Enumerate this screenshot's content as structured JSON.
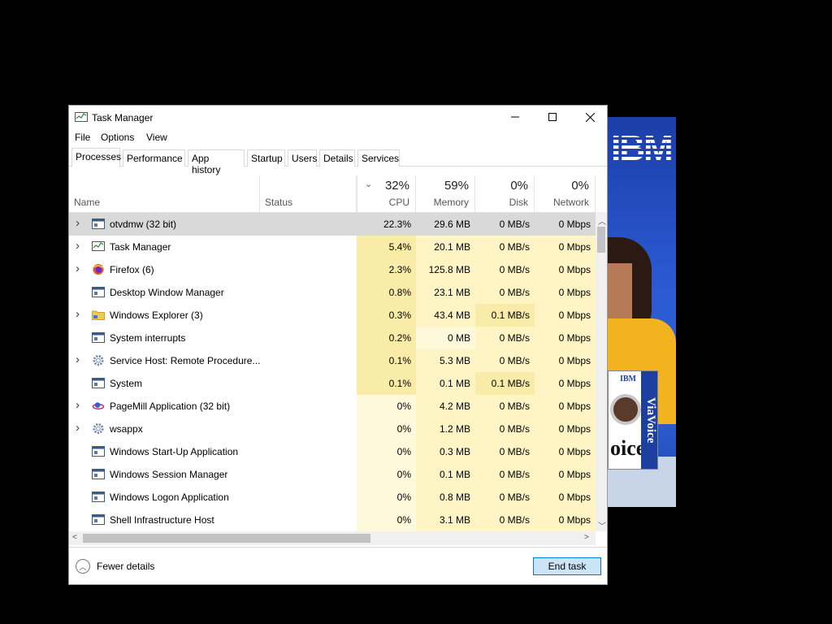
{
  "window": {
    "title": "Task Manager",
    "controls": {
      "minimize": "—",
      "maximize": "☐",
      "close": "✕"
    }
  },
  "menu": [
    "File",
    "Options",
    "View"
  ],
  "tabs": [
    "Processes",
    "Performance",
    "App history",
    "Startup",
    "Users",
    "Details",
    "Services"
  ],
  "active_tab": "Processes",
  "columns": {
    "name": "Name",
    "status": "Status",
    "cpu": {
      "pct": "32%",
      "label": "CPU"
    },
    "memory": {
      "pct": "59%",
      "label": "Memory"
    },
    "disk": {
      "pct": "0%",
      "label": "Disk"
    },
    "network": {
      "pct": "0%",
      "label": "Network"
    }
  },
  "rows": [
    {
      "name": "otvdmw (32 bit)",
      "expand": true,
      "icon": "app-window-icon",
      "cpu": "22.3%",
      "mem": "29.6 MB",
      "disk": "0 MB/s",
      "net": "0 Mbps",
      "selected": true
    },
    {
      "name": "Task Manager",
      "expand": true,
      "icon": "task-manager-icon",
      "cpu": "5.4%",
      "mem": "20.1 MB",
      "disk": "0 MB/s",
      "net": "0 Mbps"
    },
    {
      "name": "Firefox (6)",
      "expand": true,
      "icon": "firefox-icon",
      "cpu": "2.3%",
      "mem": "125.8 MB",
      "disk": "0 MB/s",
      "net": "0 Mbps"
    },
    {
      "name": "Desktop Window Manager",
      "expand": false,
      "icon": "app-window-icon",
      "cpu": "0.8%",
      "mem": "23.1 MB",
      "disk": "0 MB/s",
      "net": "0 Mbps"
    },
    {
      "name": "Windows Explorer (3)",
      "expand": true,
      "icon": "folder-icon",
      "cpu": "0.3%",
      "mem": "43.4 MB",
      "disk": "0.1 MB/s",
      "net": "0 Mbps"
    },
    {
      "name": "System interrupts",
      "expand": false,
      "icon": "app-window-icon",
      "cpu": "0.2%",
      "mem": "0 MB",
      "disk": "0 MB/s",
      "net": "0 Mbps"
    },
    {
      "name": "Service Host: Remote Procedure...",
      "expand": true,
      "icon": "gear-icon",
      "cpu": "0.1%",
      "mem": "5.3 MB",
      "disk": "0 MB/s",
      "net": "0 Mbps"
    },
    {
      "name": "System",
      "expand": false,
      "icon": "app-window-icon",
      "cpu": "0.1%",
      "mem": "0.1 MB",
      "disk": "0.1 MB/s",
      "net": "0 Mbps"
    },
    {
      "name": "PageMill Application (32 bit)",
      "expand": true,
      "icon": "pagemill-icon",
      "cpu": "0%",
      "mem": "4.2 MB",
      "disk": "0 MB/s",
      "net": "0 Mbps"
    },
    {
      "name": "wsappx",
      "expand": true,
      "icon": "gear-icon",
      "cpu": "0%",
      "mem": "1.2 MB",
      "disk": "0 MB/s",
      "net": "0 Mbps"
    },
    {
      "name": "Windows Start-Up Application",
      "expand": false,
      "icon": "app-window-icon",
      "cpu": "0%",
      "mem": "0.3 MB",
      "disk": "0 MB/s",
      "net": "0 Mbps"
    },
    {
      "name": "Windows Session Manager",
      "expand": false,
      "icon": "app-window-icon",
      "cpu": "0%",
      "mem": "0.1 MB",
      "disk": "0 MB/s",
      "net": "0 Mbps"
    },
    {
      "name": "Windows Logon Application",
      "expand": false,
      "icon": "app-window-icon",
      "cpu": "0%",
      "mem": "0.8 MB",
      "disk": "0 MB/s",
      "net": "0 Mbps"
    },
    {
      "name": "Shell Infrastructure Host",
      "expand": false,
      "icon": "app-window-icon",
      "cpu": "0%",
      "mem": "3.1 MB",
      "disk": "0 MB/s",
      "net": "0 Mbps"
    }
  ],
  "footer": {
    "fewer_details": "Fewer details",
    "end_task": "End task"
  },
  "ad": {
    "brand": "IBM",
    "product": "ViaVoice",
    "partial_word": "oice"
  },
  "colors": {
    "heat_low": "#fff9dc",
    "heat_mid": "#fff4c4",
    "heat_high": "#f9eca8",
    "selection": "#d9d9d9",
    "accent": "#0078d7"
  }
}
